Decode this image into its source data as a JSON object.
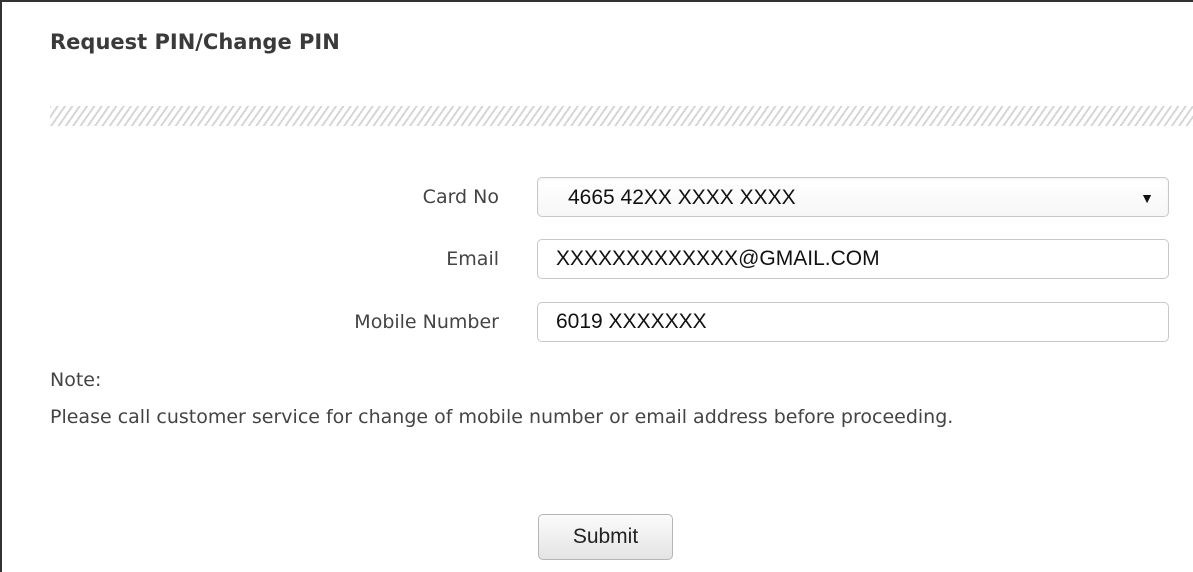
{
  "title": "Request PIN/Change PIN",
  "form": {
    "card": {
      "label": "Card No",
      "selected_value": "4665 42XX XXXX XXXX",
      "arrow_icon": "▼"
    },
    "email": {
      "label": "Email",
      "value": "XXXXXXXXXXXXX@GMAIL.COM"
    },
    "mobile": {
      "label": "Mobile Number",
      "value": "6019 XXXXXXX"
    }
  },
  "note": {
    "label": "Note:",
    "text": "Please call customer service for change of mobile number or email address before proceeding."
  },
  "submit_label": "Submit"
}
